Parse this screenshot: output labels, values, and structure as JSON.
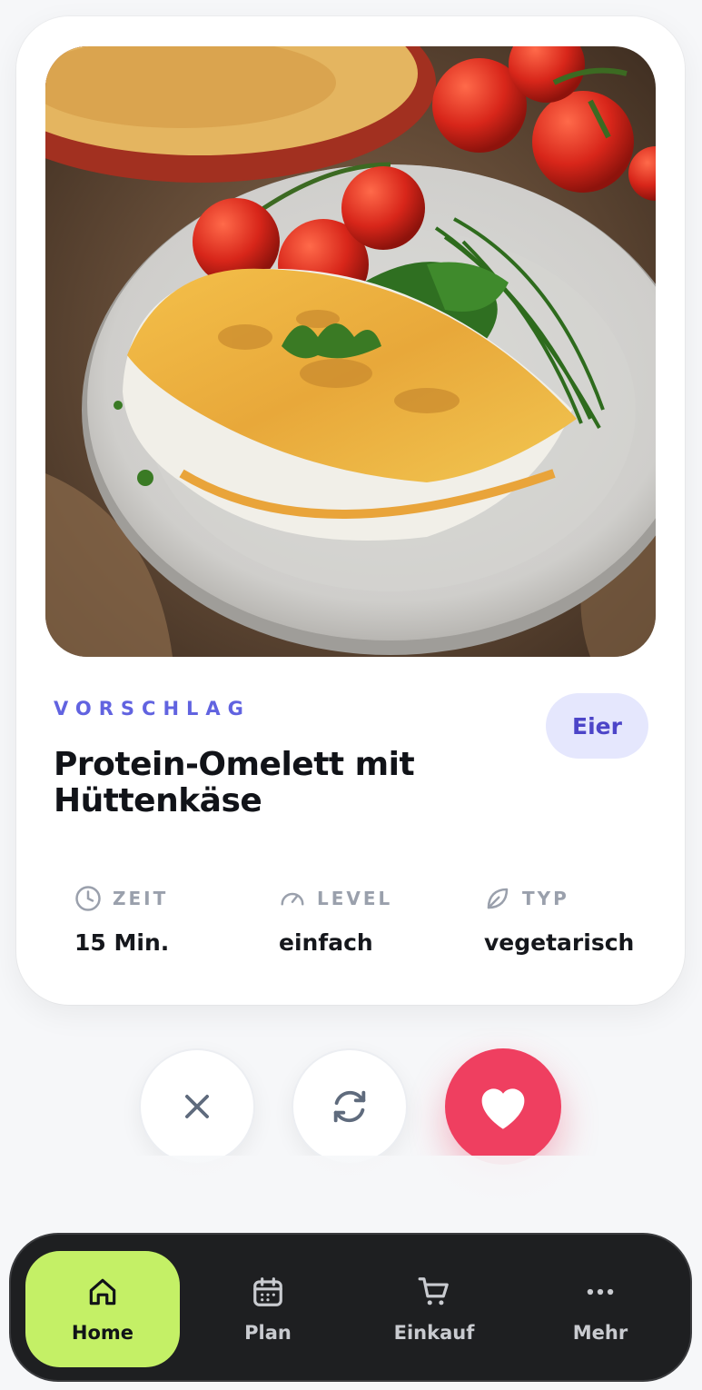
{
  "recipe": {
    "label": "VORSCHLAG",
    "category": "Eier",
    "title": "Protein-Omelett mit Hüttenkäse",
    "image_alt": "Omelett mit Hüttenkäse, Kirschtomaten und Schnittlauch auf einem Teller"
  },
  "meta": [
    {
      "label": "ZEIT",
      "value": "15 Min.",
      "icon": "clock-icon"
    },
    {
      "label": "LEVEL",
      "value": "einfach",
      "icon": "gauge-icon"
    },
    {
      "label": "TYP",
      "value": "vegetarisch",
      "icon": "leaf-icon"
    }
  ],
  "actions": {
    "dismiss_icon": "close-icon",
    "refresh_icon": "refresh-icon",
    "like_icon": "heart-icon"
  },
  "nav": [
    {
      "label": "Home",
      "icon": "home-icon",
      "active": true
    },
    {
      "label": "Plan",
      "icon": "calendar-icon",
      "active": false
    },
    {
      "label": "Einkauf",
      "icon": "cart-icon",
      "active": false
    },
    {
      "label": "Mehr",
      "icon": "more-icon",
      "active": false
    }
  ],
  "colors": {
    "accent": "#6163e0",
    "chip_bg": "#e5e7fd",
    "like": "#ef3f60",
    "nav_bg": "#1e1f21",
    "nav_active": "#c4f066"
  }
}
